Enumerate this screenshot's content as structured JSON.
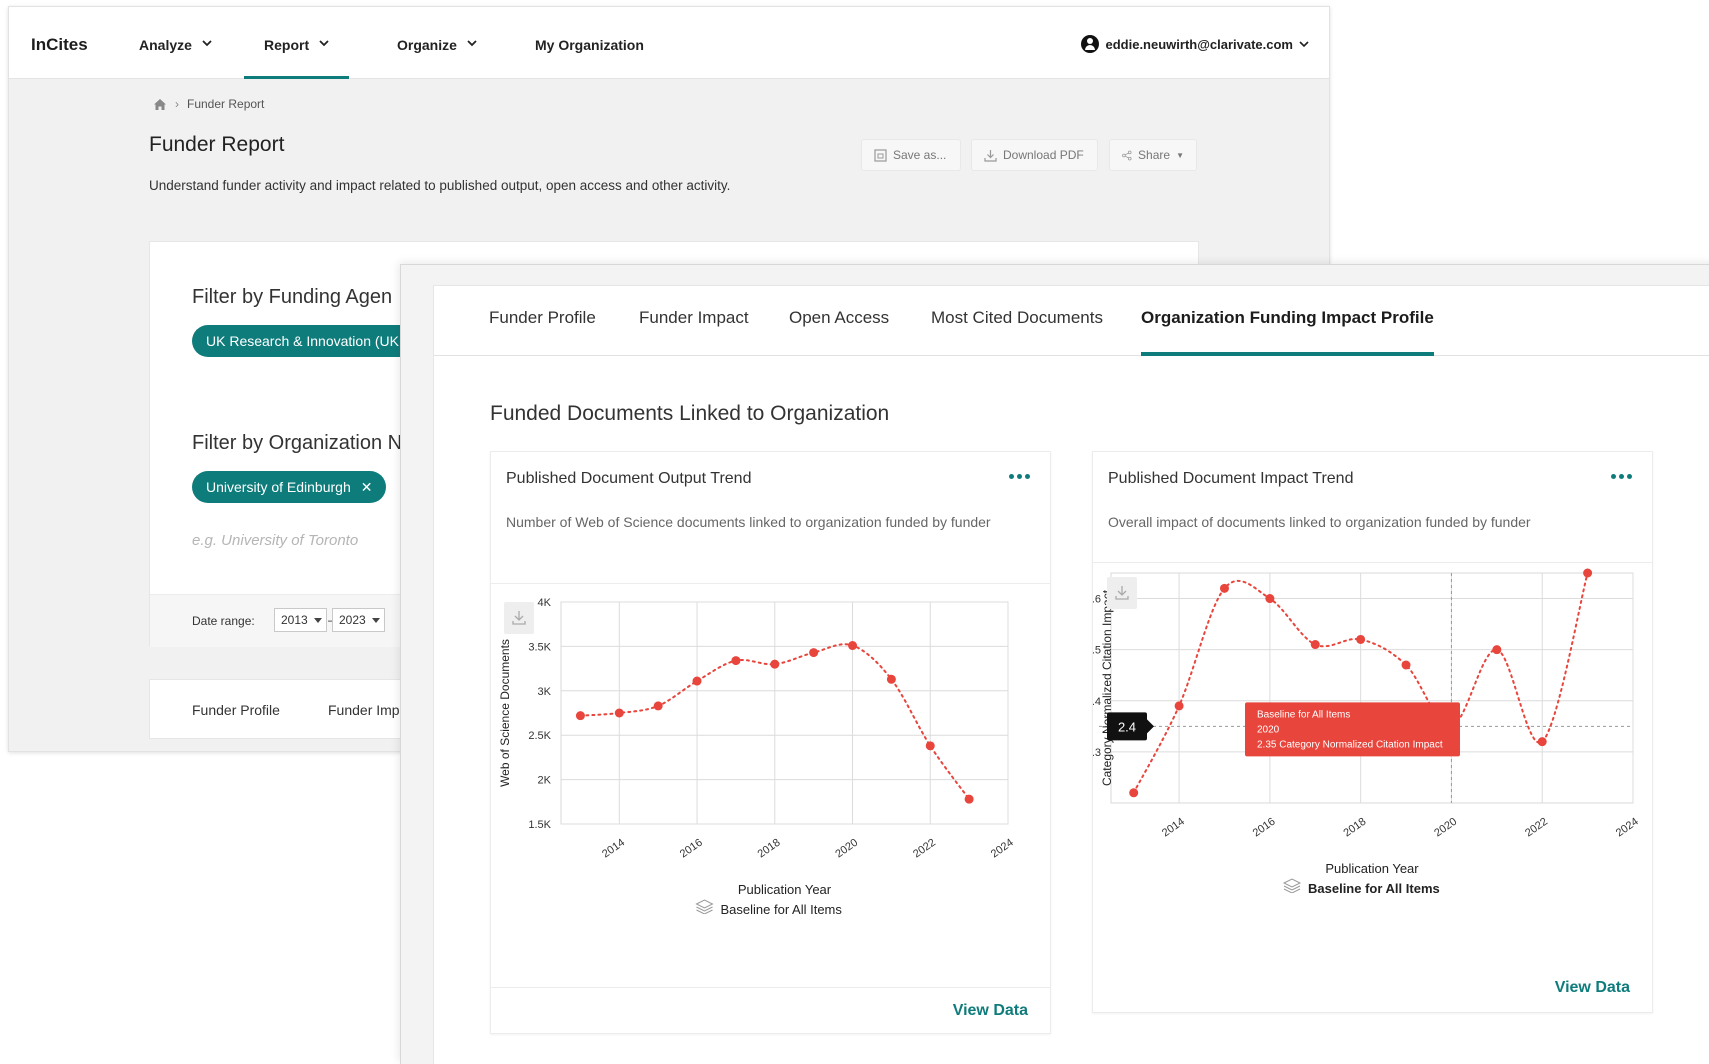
{
  "app": {
    "logo": "InCites"
  },
  "nav": {
    "items": [
      {
        "label": "Analyze"
      },
      {
        "label": "Report"
      },
      {
        "label": "Organize"
      },
      {
        "label": "My Organization"
      }
    ],
    "user_email": "eddie.neuwirth@clarivate.com"
  },
  "breadcrumb": {
    "current": "Funder Report"
  },
  "page": {
    "title": "Funder Report",
    "description": "Understand funder activity and impact related to published output, open access and other activity."
  },
  "actions": {
    "save_as": "Save as...",
    "download_pdf": "Download PDF",
    "share": "Share"
  },
  "filters": {
    "funding_title": "Filter by Funding Agen",
    "funding_chip": "UK Research & Innovation (UKR",
    "org_title": "Filter by Organization N",
    "org_chip": "University of Edinburgh",
    "org_placeholder": "e.g. University of Toronto",
    "date_label": "Date range:",
    "date_from": "2013",
    "date_to": "2023"
  },
  "back_tabs": [
    "Funder Profile",
    "Funder Impac"
  ],
  "tabs": [
    {
      "label": "Funder Profile"
    },
    {
      "label": "Funder Impact"
    },
    {
      "label": "Open Access"
    },
    {
      "label": "Most Cited Documents"
    },
    {
      "label": "Organization Funding Impact Profile",
      "active": true
    }
  ],
  "section_title": "Funded Documents Linked to Organization",
  "cards": {
    "output": {
      "title": "Published Document Output Trend",
      "description": "Number of Web of Science documents linked to organization funded by funder",
      "view_data": "View Data"
    },
    "impact": {
      "title": "Published Document Impact Trend",
      "description": "Overall impact of documents linked to organization funded by funder",
      "view_data": "View Data"
    }
  },
  "chart_data": [
    {
      "type": "line",
      "title": "Published Document Output Trend",
      "xlabel": "Publication Year",
      "ylabel": "Web of Science Documents",
      "legend": "Baseline for All Items",
      "x": [
        2013,
        2014,
        2015,
        2016,
        2017,
        2018,
        2019,
        2020,
        2021,
        2022,
        2023
      ],
      "values": [
        2720,
        2750,
        2830,
        3110,
        3340,
        3300,
        3430,
        3510,
        3130,
        2380,
        1780
      ],
      "xticks": [
        "2014",
        "2016",
        "2018",
        "2020",
        "2022",
        "2024"
      ],
      "yticks": [
        "1.5K",
        "2K",
        "2.5K",
        "3K",
        "3.5K",
        "4K"
      ],
      "ylim": [
        1500,
        4000
      ],
      "xlim": [
        2012.5,
        2024
      ],
      "color": "#e8453c"
    },
    {
      "type": "line",
      "title": "Published Document Impact Trend",
      "xlabel": "Publication Year",
      "ylabel": "Category Normalized Citation Impact",
      "legend": "Baseline for All Items",
      "x": [
        2013,
        2014,
        2015,
        2016,
        2017,
        2018,
        2019,
        2020,
        2021,
        2022,
        2023
      ],
      "values": [
        2.22,
        2.39,
        2.62,
        2.6,
        2.51,
        2.52,
        2.47,
        2.35,
        2.5,
        2.32,
        2.65
      ],
      "baseline": 2.35,
      "baseline_label": "2.4",
      "tooltip": [
        "Baseline for All Items",
        "2020",
        "2.35 Category Normalized Citation Impact"
      ],
      "xticks": [
        "2014",
        "2016",
        "2018",
        "2020",
        "2022",
        "2024"
      ],
      "yticks": [
        "2.3",
        "2.4",
        "2.5",
        "2.6"
      ],
      "ylim": [
        2.2,
        2.65
      ],
      "xlim": [
        2012.5,
        2024
      ],
      "color": "#e8453c",
      "tooltip_color": "#e8453c"
    }
  ]
}
